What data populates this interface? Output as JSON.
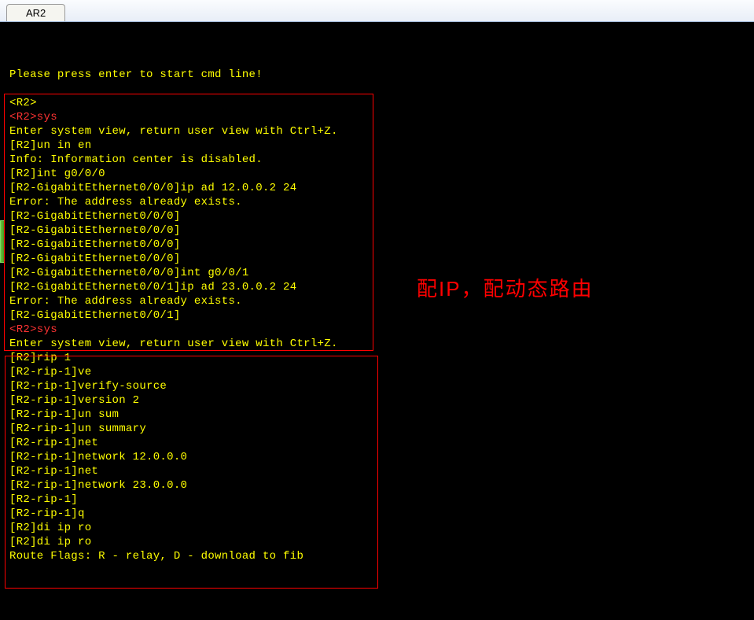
{
  "tab": {
    "label": "AR2"
  },
  "annotation": "配IP，配动态路由",
  "lines": [
    {
      "text": "Please press enter to start cmd line!",
      "cls": ""
    },
    {
      "text": "",
      "cls": ""
    },
    {
      "text": "<R2>",
      "cls": ""
    },
    {
      "text": "<R2>sys",
      "cls": "red-line"
    },
    {
      "text": "Enter system view, return user view with Ctrl+Z.",
      "cls": ""
    },
    {
      "text": "[R2]un in en",
      "cls": ""
    },
    {
      "text": "Info: Information center is disabled.",
      "cls": ""
    },
    {
      "text": "[R2]int g0/0/0",
      "cls": ""
    },
    {
      "text": "[R2-GigabitEthernet0/0/0]ip ad 12.0.0.2 24",
      "cls": ""
    },
    {
      "text": "Error: The address already exists.",
      "cls": ""
    },
    {
      "text": "[R2-GigabitEthernet0/0/0]",
      "cls": ""
    },
    {
      "text": "[R2-GigabitEthernet0/0/0]",
      "cls": ""
    },
    {
      "text": "[R2-GigabitEthernet0/0/0]",
      "cls": ""
    },
    {
      "text": "[R2-GigabitEthernet0/0/0]",
      "cls": ""
    },
    {
      "text": "[R2-GigabitEthernet0/0/0]int g0/0/1",
      "cls": ""
    },
    {
      "text": "[R2-GigabitEthernet0/0/1]ip ad 23.0.0.2 24",
      "cls": ""
    },
    {
      "text": "Error: The address already exists.",
      "cls": ""
    },
    {
      "text": "[R2-GigabitEthernet0/0/1]",
      "cls": ""
    },
    {
      "text": "<R2>sys",
      "cls": "red-line"
    },
    {
      "text": "Enter system view, return user view with Ctrl+Z.",
      "cls": ""
    },
    {
      "text": "[R2]rip 1",
      "cls": ""
    },
    {
      "text": "[R2-rip-1]ve",
      "cls": ""
    },
    {
      "text": "[R2-rip-1]verify-source",
      "cls": ""
    },
    {
      "text": "[R2-rip-1]version 2",
      "cls": ""
    },
    {
      "text": "[R2-rip-1]un sum",
      "cls": ""
    },
    {
      "text": "[R2-rip-1]un summary",
      "cls": ""
    },
    {
      "text": "[R2-rip-1]net",
      "cls": ""
    },
    {
      "text": "[R2-rip-1]network 12.0.0.0",
      "cls": ""
    },
    {
      "text": "[R2-rip-1]net",
      "cls": ""
    },
    {
      "text": "[R2-rip-1]network 23.0.0.0",
      "cls": ""
    },
    {
      "text": "[R2-rip-1]",
      "cls": ""
    },
    {
      "text": "[R2-rip-1]q",
      "cls": ""
    },
    {
      "text": "[R2]di ip ro",
      "cls": ""
    },
    {
      "text": "[R2]di ip ro",
      "cls": ""
    },
    {
      "text": "Route Flags: R - relay, D - download to fib",
      "cls": ""
    }
  ]
}
